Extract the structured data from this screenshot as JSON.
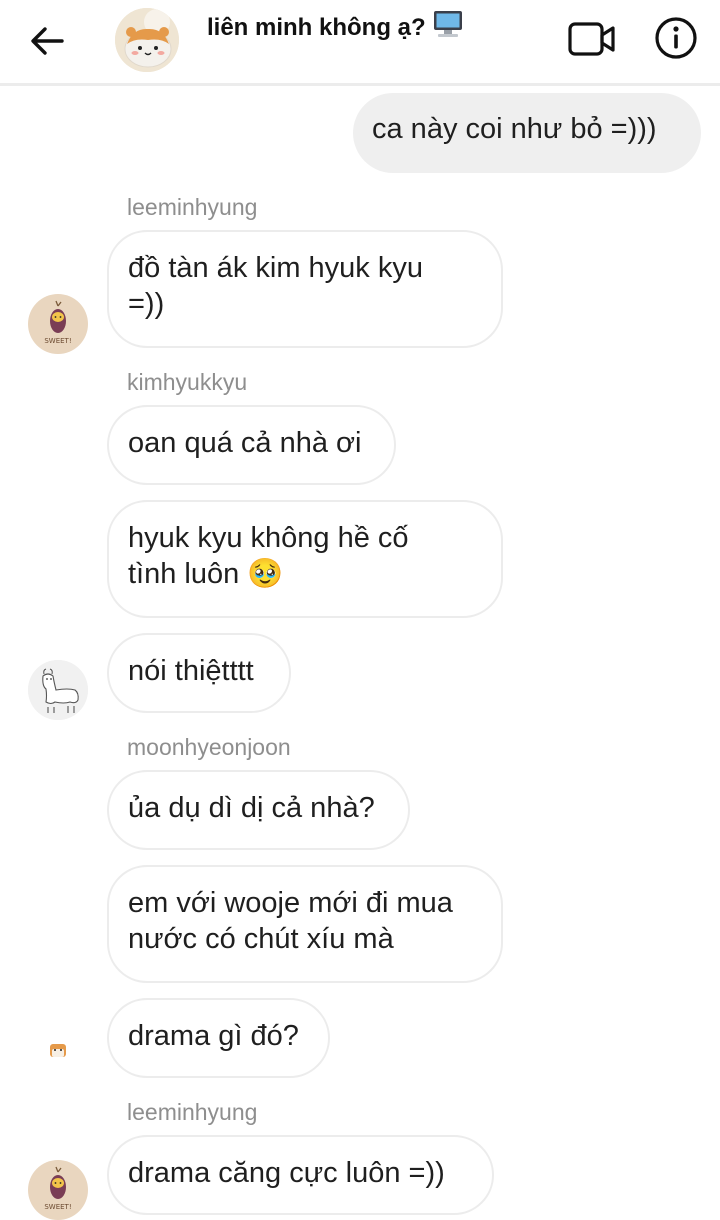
{
  "header": {
    "title": "liên minh không ạ?",
    "title_emoji": "🖥️",
    "back_icon": "arrow-left-icon",
    "video_icon": "video-camera-icon",
    "info_icon": "info-icon"
  },
  "messages": [
    {
      "type": "outgoing",
      "text": "ca này coi như bỏ =)))"
    },
    {
      "type": "sender",
      "name": "leeminhyung"
    },
    {
      "type": "incoming",
      "text_lines": [
        "đồ tàn ák kim hyuk kyu",
        "=))"
      ]
    },
    {
      "type": "sender",
      "name": "kimhyukkyu"
    },
    {
      "type": "incoming",
      "text": "oan quá cả nhà ơi"
    },
    {
      "type": "incoming",
      "text_lines": [
        "hyuk kyu không hề cố",
        "tình luôn"
      ],
      "emoji": "🥹"
    },
    {
      "type": "incoming",
      "text": "nói thiệtttt"
    },
    {
      "type": "sender",
      "name": "moonhyeonjoon"
    },
    {
      "type": "incoming",
      "text": "ủa dụ dì dị cả nhà?"
    },
    {
      "type": "incoming",
      "text_lines": [
        "em với wooje mới đi mua",
        "nước có chút xíu mà"
      ]
    },
    {
      "type": "incoming",
      "text": "drama gì đó?"
    },
    {
      "type": "sender",
      "name": "leeminhyung"
    },
    {
      "type": "incoming",
      "text": "drama căng cực luôn =))"
    }
  ],
  "avatars": {
    "sweet_potato_label": "SWEET!"
  },
  "colors": {
    "incoming_border": "#ececec",
    "outgoing_bg": "#efefef",
    "sender_text": "#8e8e8e"
  }
}
